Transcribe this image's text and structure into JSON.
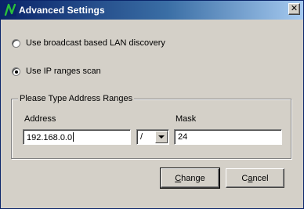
{
  "window": {
    "title": "Advanced Settings",
    "close_glyph": "✕",
    "icon": "app-n-logo-icon",
    "colors": {
      "titlebar_start": "#0a246a",
      "titlebar_end": "#a6caf0",
      "face": "#d4d0c8",
      "logo_green": "#2bbf3b"
    }
  },
  "discovery": {
    "options": [
      {
        "label": "Use broadcast based LAN discovery",
        "selected": false
      },
      {
        "label": "Use IP ranges scan",
        "selected": true
      }
    ]
  },
  "ranges": {
    "group_title": "Please Type Address Ranges",
    "address_label": "Address",
    "address_value": "192.168.0.0",
    "separator_value": "/",
    "mask_label": "Mask",
    "mask_value": "24"
  },
  "buttons": {
    "change_first": "C",
    "change_rest": "hange",
    "cancel_first": "C",
    "cancel_mnemonic": "a",
    "cancel_rest": "ncel"
  }
}
